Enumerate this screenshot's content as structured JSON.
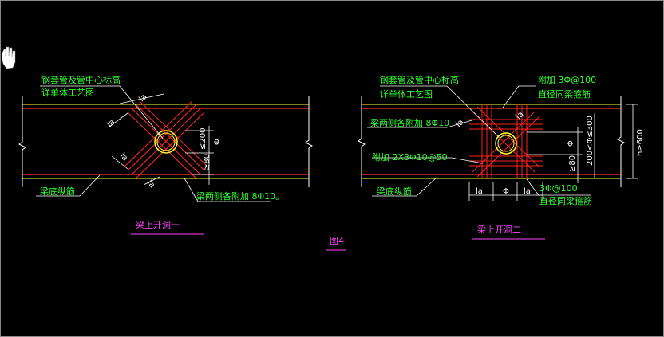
{
  "cursor_icon": "hand-cursor-icon",
  "left_detail": {
    "note_sleeve": "钢套管及管中心标高",
    "note_sleeve_2": "详单体工艺图",
    "note_bottom_bars": "梁底纵筋",
    "note_side_bars": "梁两侧各附加  8Φ10。",
    "dim_la": "la",
    "dim_200": "≤200",
    "dim_phi": "Φ",
    "dim_80": "≥80",
    "caption": "梁上开洞一"
  },
  "right_detail": {
    "note_sleeve": "钢套管及管中心标高",
    "note_sleeve_2": "详单体工艺图",
    "note_stirrups": "附加 3Φ@100",
    "note_stirrups_2": "直径同梁箍筋",
    "note_side_bars": "梁两侧各附加  8Φ10",
    "note_extra": "附加 2X3Φ10@50",
    "note_bottom_bars": "梁底纵筋",
    "dim_la": "la",
    "dim_phi": "Φ",
    "dim_80": "≥80",
    "dim_300": "200<Φ≤300",
    "dim_h600": "h≥600",
    "dim_stirrups_bottom": "3Φ@100",
    "dim_stirrups_bottom_2": "直径同梁箍筋",
    "caption": "梁上开洞二"
  },
  "figure_label": "图4",
  "colors": {
    "beam": "#ff3333",
    "beam_edge": "#ffff33",
    "leader": "#ffffff",
    "text": "#33ff33",
    "caption": "#ff44ff",
    "rebar": "#ff2222"
  }
}
